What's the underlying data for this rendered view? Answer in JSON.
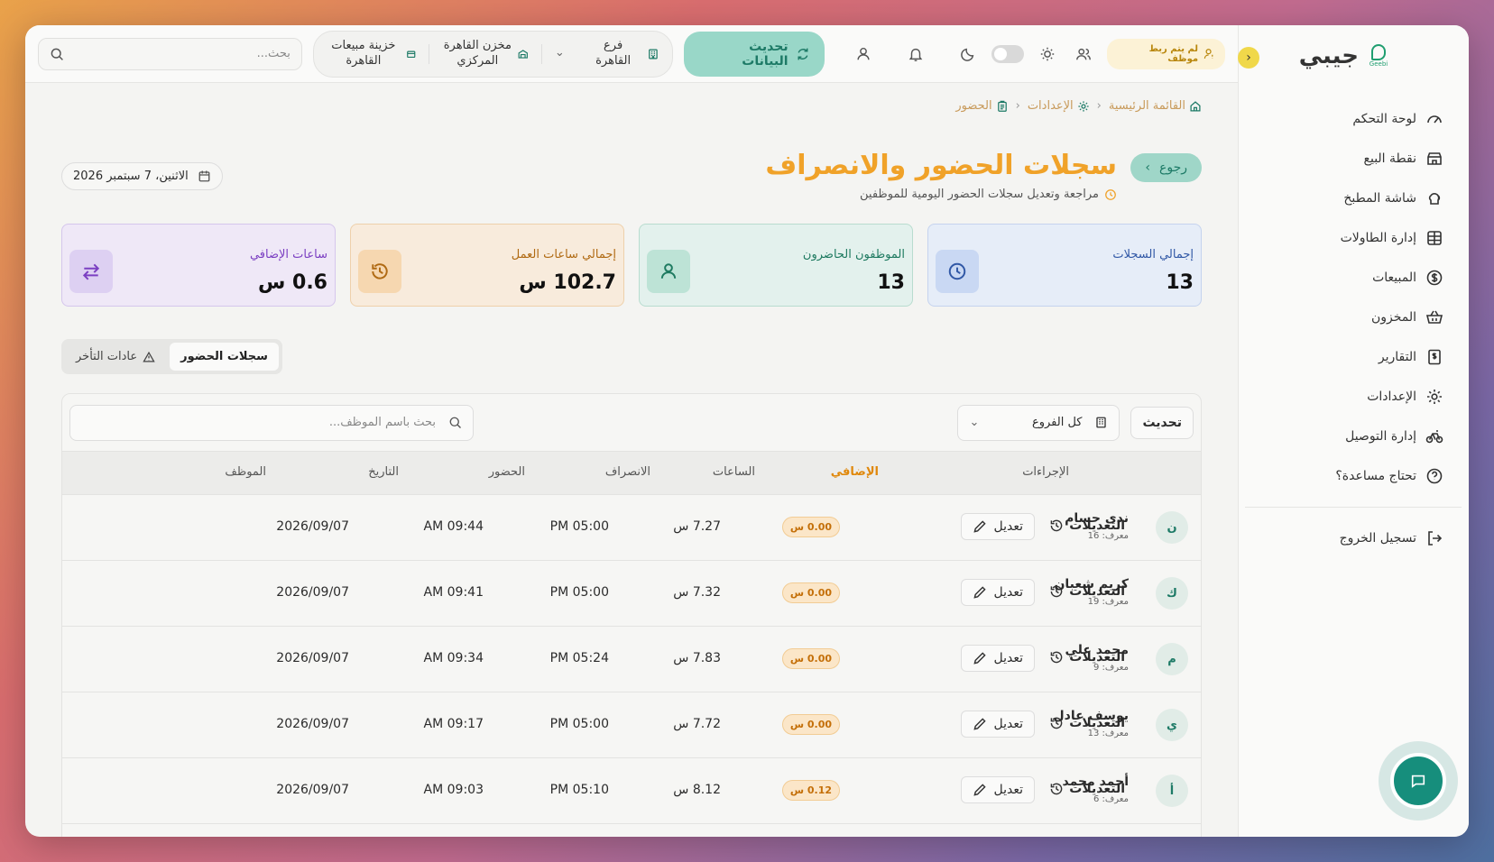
{
  "brand": {
    "name": "جيبي",
    "logo_sub": "Geebi"
  },
  "topbar": {
    "warning": "لم يتم ربط موظف",
    "sync_label": "تحديث البيانات",
    "branch": "فرع القاهرة",
    "warehouse": "مخزن القاهرة المركزي",
    "cashbox": "خزينة مبيعات القاهرة",
    "search_placeholder": "بحث..."
  },
  "sidebar": {
    "items": [
      {
        "label": "لوحة التحكم",
        "icon": "gauge-icon"
      },
      {
        "label": "نقطة البيع",
        "icon": "store-icon"
      },
      {
        "label": "شاشة المطبخ",
        "icon": "chef-hat-icon"
      },
      {
        "label": "إدارة الطاولات",
        "icon": "table-grid-icon"
      },
      {
        "label": "المبيعات",
        "icon": "dollar-icon"
      },
      {
        "label": "المخزون",
        "icon": "basket-icon"
      },
      {
        "label": "التقارير",
        "icon": "report-icon"
      },
      {
        "label": "الإعدادات",
        "icon": "gear-icon"
      },
      {
        "label": "إدارة التوصيل",
        "icon": "bike-icon"
      },
      {
        "label": "تحتاج مساعدة؟",
        "icon": "help-icon"
      }
    ],
    "logout": "تسجيل الخروج"
  },
  "breadcrumb": {
    "home": "القائمة الرئيسية",
    "settings": "الإعدادات",
    "current": "الحضور"
  },
  "header": {
    "back": "رجوع",
    "title": "سجلات الحضور والانصراف",
    "subtitle": "مراجعة وتعديل سجلات الحضور اليومية للموظفين",
    "date": "الاثنين، 7 سبتمبر 2026"
  },
  "stats": {
    "total_records": {
      "label": "إجمالي السجلات",
      "value": "13"
    },
    "present": {
      "label": "الموظفون الحاضرون",
      "value": "13"
    },
    "work_hours": {
      "label": "إجمالي ساعات العمل",
      "value": "102.7 س"
    },
    "overtime": {
      "label": "ساعات الإضافي",
      "value": "0.6 س"
    }
  },
  "tabs": {
    "records": "سجلات الحضور",
    "late": "عادات التأخر"
  },
  "filters": {
    "refresh": "تحديث",
    "branch": "كل الفروع",
    "search_placeholder": "بحث باسم الموظف..."
  },
  "table": {
    "headers": {
      "employee": "الموظف",
      "date": "التاريخ",
      "check_in": "الحضور",
      "check_out": "الانصراف",
      "hours": "الساعات",
      "overtime": "الإضافي",
      "actions": "الإجراءات"
    },
    "edit_label": "تعديل",
    "history_label": "التعديلات",
    "rows": [
      {
        "initial": "ن",
        "name": "ندى حسام",
        "id": "معرف: 16",
        "date": "2026/09/07",
        "in": "09:44 AM",
        "out": "05:00 PM",
        "hours": "7.27 س",
        "ot": "0.00 س"
      },
      {
        "initial": "ك",
        "name": "كريم شعبان",
        "id": "معرف: 19",
        "date": "2026/09/07",
        "in": "09:41 AM",
        "out": "05:00 PM",
        "hours": "7.32 س",
        "ot": "0.00 س"
      },
      {
        "initial": "م",
        "name": "محمد علي",
        "id": "معرف: 9",
        "date": "2026/09/07",
        "in": "09:34 AM",
        "out": "05:24 PM",
        "hours": "7.83 س",
        "ot": "0.00 س"
      },
      {
        "initial": "ي",
        "name": "يوسف عادل",
        "id": "معرف: 13",
        "date": "2026/09/07",
        "in": "09:17 AM",
        "out": "05:00 PM",
        "hours": "7.72 س",
        "ot": "0.00 س"
      },
      {
        "initial": "أ",
        "name": "أحمد محمد",
        "id": "معرف: 6",
        "date": "2026/09/07",
        "in": "09:03 AM",
        "out": "05:10 PM",
        "hours": "8.12 س",
        "ot": "0.12 س"
      }
    ]
  },
  "colors": {
    "accent": "#f0a229",
    "teal": "#1d7a66"
  }
}
